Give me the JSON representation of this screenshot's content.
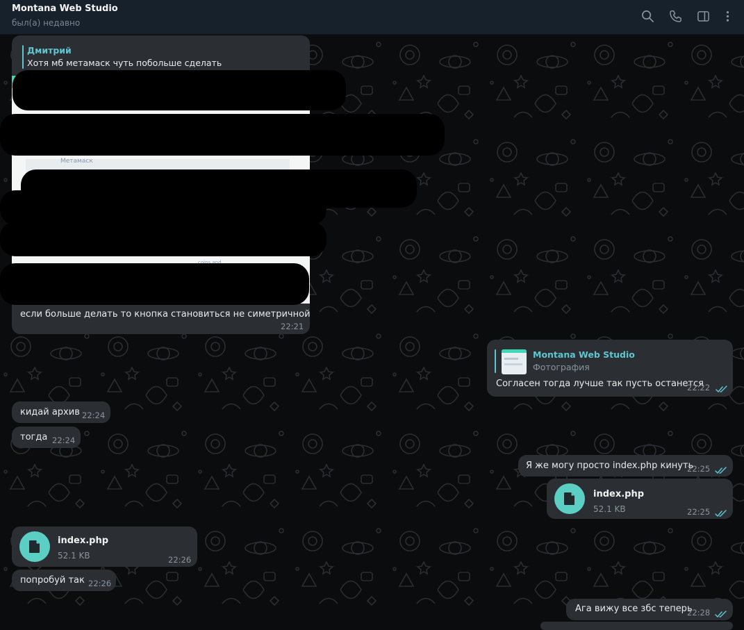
{
  "header": {
    "title": "Montana Web Studio",
    "status": "был(а) недавно",
    "icons": [
      "search-icon",
      "phone-icon",
      "sidebar-toggle-icon",
      "more-vertical-icon"
    ]
  },
  "messages": {
    "m1": {
      "reply_name": "Дмитрий",
      "reply_text": "Хотя мб метамаск чуть побольше сделать",
      "photo_text_1": "Метамаск",
      "photo_text_2": "coins and",
      "caption": "если больше делать то кнопка становиться не симетричной",
      "time": "22:21"
    },
    "m2": {
      "reply_name": "Montana Web Studio",
      "reply_sub": "Фотография",
      "text": "Согласен тогда лучше так пусть останется",
      "time": "22:22"
    },
    "m3": {
      "text": "кидай архив",
      "time": "22:24"
    },
    "m4": {
      "text": "тогда",
      "time": "22:24"
    },
    "m5": {
      "text": "Я же могу просто index.php кинуть",
      "time": "22:25"
    },
    "m6": {
      "file_name": "index.php",
      "file_size": "52.1 KB",
      "time": "22:25"
    },
    "m7": {
      "file_name": "index.php",
      "file_size": "52.1 KB",
      "time": "22:26"
    },
    "m8": {
      "text": "попробуй так",
      "time": "22:26"
    },
    "m9": {
      "text": "Ага вижу все збс теперь",
      "time": "22:28"
    }
  },
  "colors": {
    "accent": "#5ec6d0",
    "file_icon": "#5bcfc4",
    "header_bg": "#17212b",
    "bubble_bg": "#2b2f33",
    "chat_bg": "#0b0c0e"
  }
}
